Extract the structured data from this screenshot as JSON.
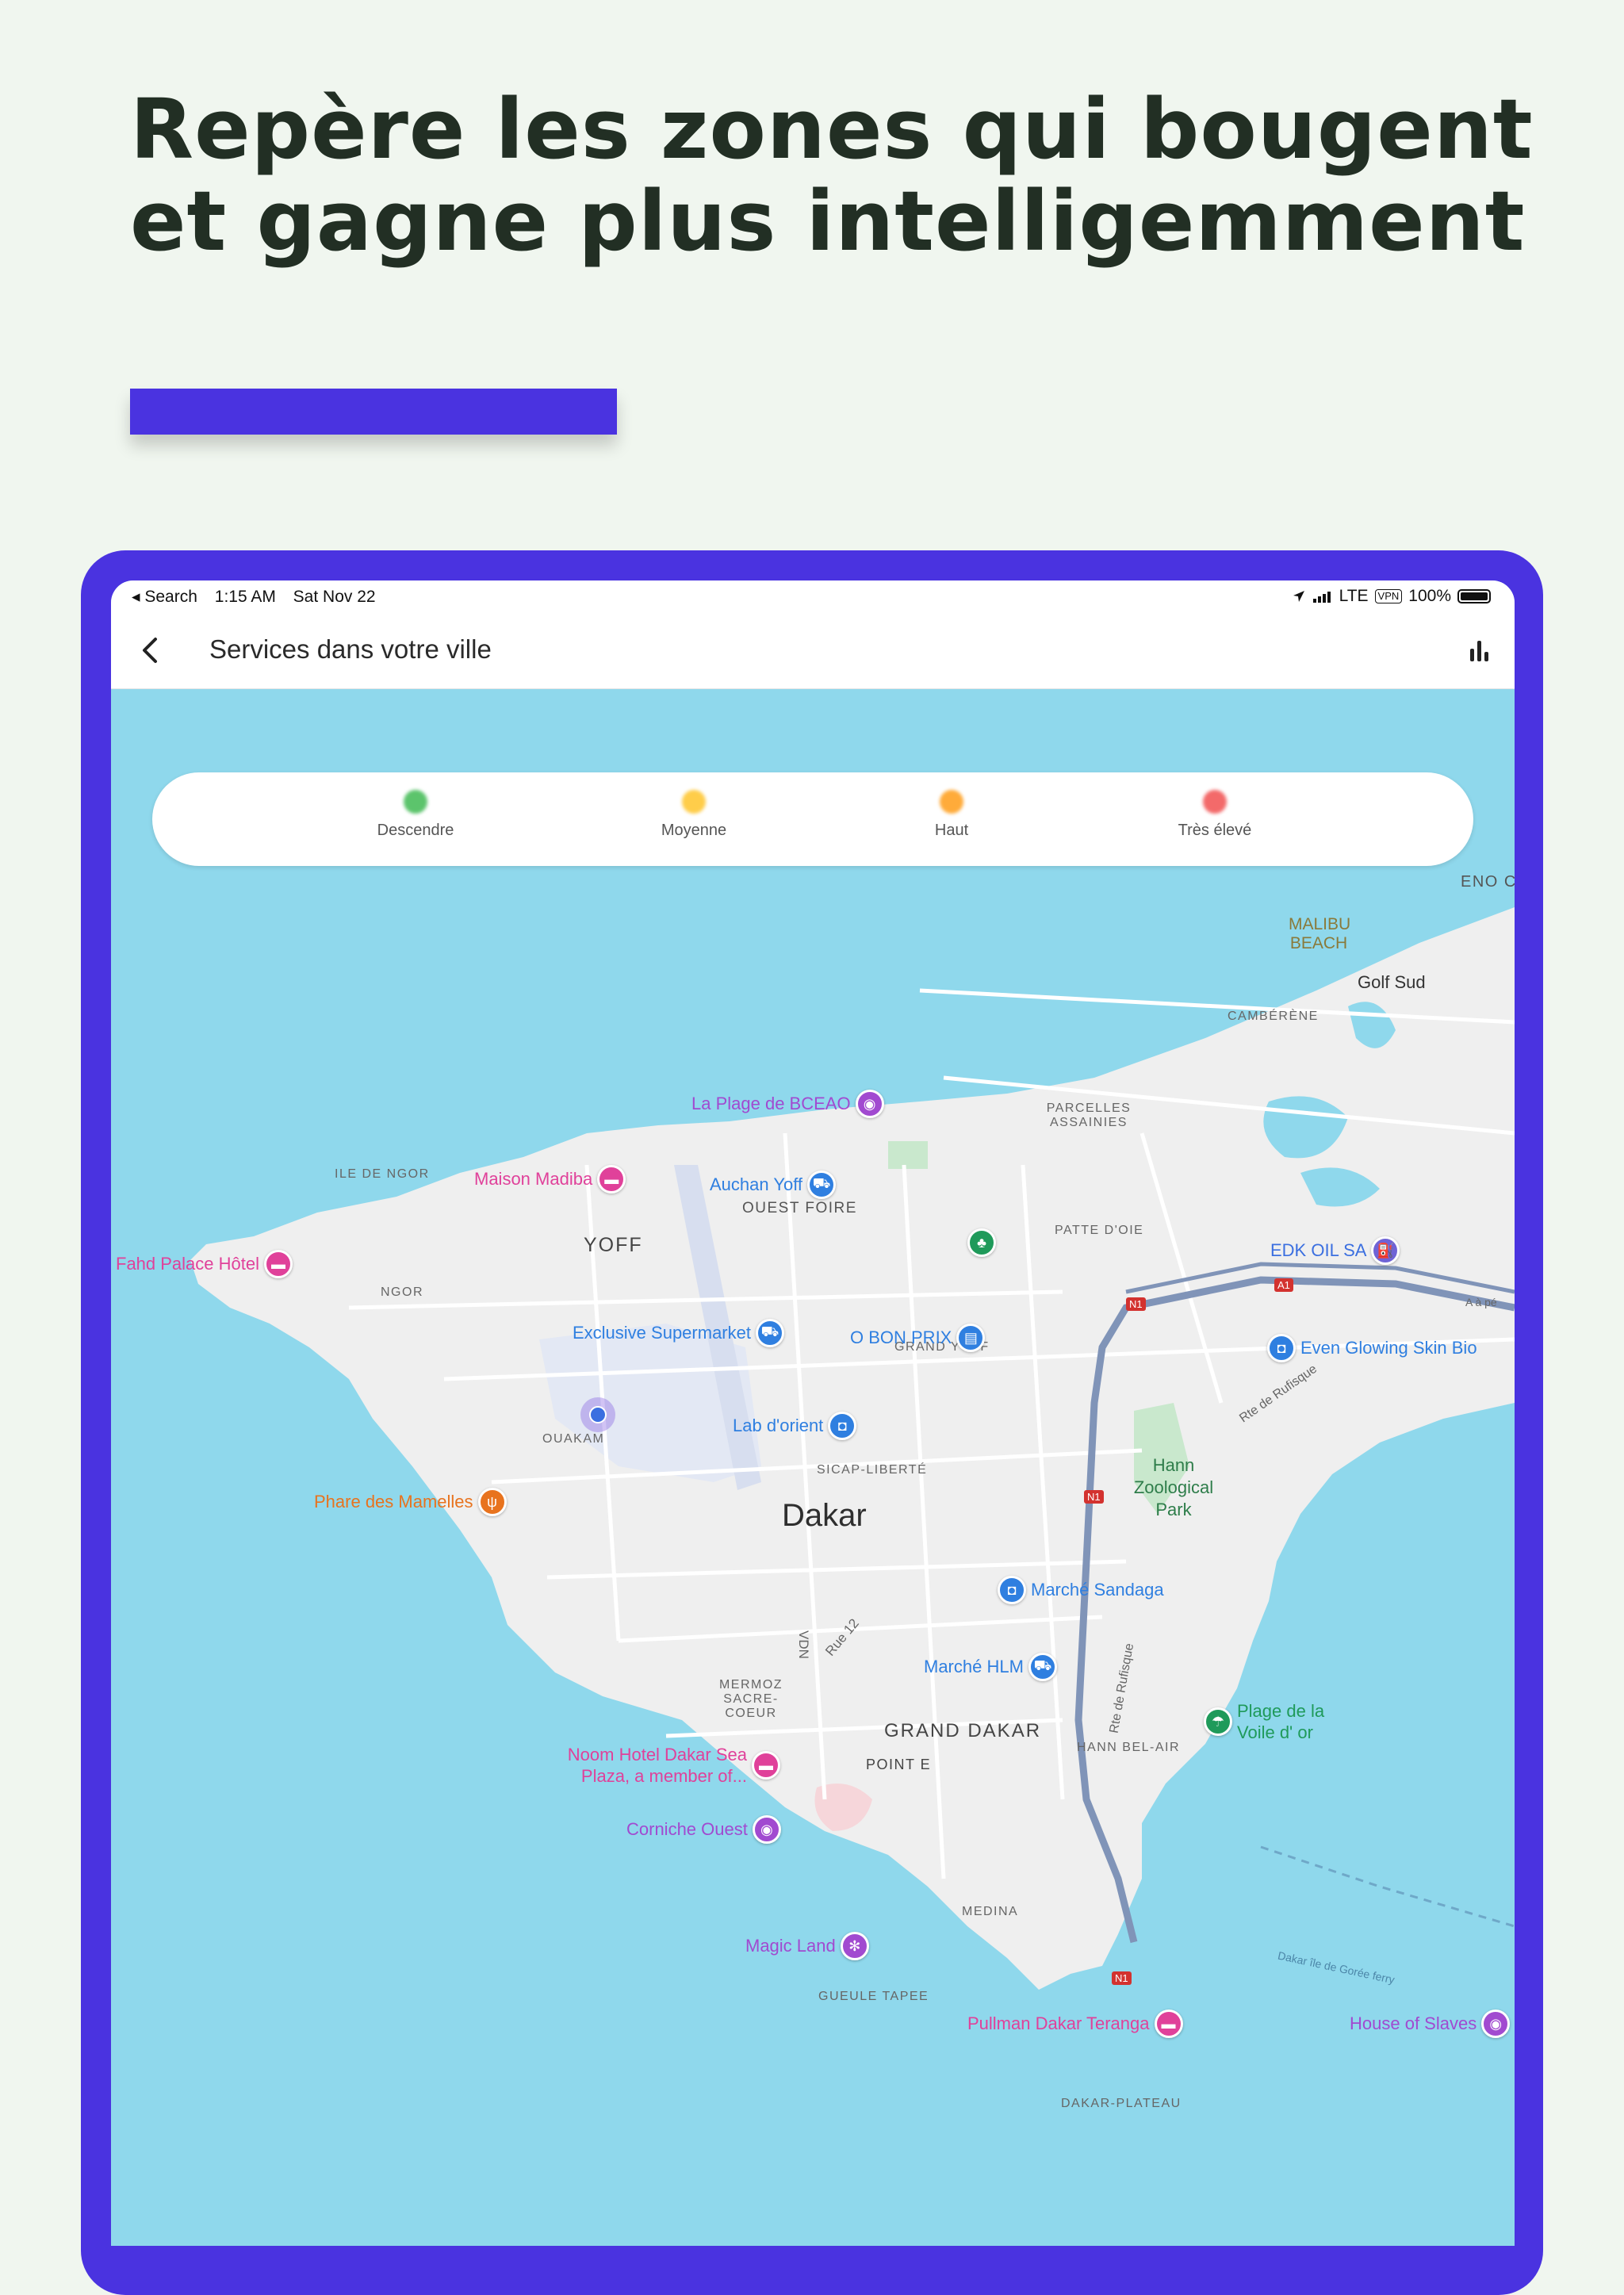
{
  "headline": {
    "line1": "Repère les zones qui bougent",
    "line2": "et gagne plus intelligemment"
  },
  "statusbar": {
    "back_app": "◂ Search",
    "time": "1:15 AM",
    "date": "Sat Nov 22",
    "network": "LTE",
    "vpn": "VPN",
    "battery": "100%"
  },
  "appbar": {
    "title": "Services dans votre ville"
  },
  "legend": {
    "items": [
      {
        "label": "Descendre",
        "color": "#5cc46c"
      },
      {
        "label": "Moyenne",
        "color": "#ffcd4a"
      },
      {
        "label": "Haut",
        "color": "#ffab3a"
      },
      {
        "label": "Très élevé",
        "color": "#f36a6a"
      }
    ]
  },
  "map": {
    "city": "Dakar",
    "districts": {
      "yoff": "YOFF",
      "ouest_foire": "OUEST FOIRE",
      "ile_de_ngor": "ILE DE NGOR",
      "ngor": "NGOR",
      "ouakam": "OUAKAM",
      "patte_doie": "PATTE D'OIE",
      "parcelles": "PARCELLES ASSAINIES",
      "cambere": "CAMBÉRÈNE",
      "grand_yoff": "GRAND YOFF",
      "sicap": "SICAP-LIBERTÉ",
      "mermoz": "MERMOZ SACRE-COEUR",
      "grand_dakar": "GRAND DAKAR",
      "point_e": "POINT E",
      "hann_bel_air": "HANN BEL-AIR",
      "medina": "MEDINA",
      "gueule_tapee": "GUEULE TAPEE",
      "dakar_plateau": "DAKAR-PLATEAU",
      "golf_sud": "Golf Sud",
      "malibu": "MALIBU BEACH",
      "eno": "ENO C"
    },
    "roads": {
      "vdn": "VDN",
      "rue12": "Rue 12",
      "rte_rufisque1": "Rte de Rufisque",
      "rte_rufisque2": "Rte de Rufisque",
      "ferry": "Dakar île de Gorée ferry",
      "n1": "N1",
      "a1": "A1",
      "a_pe": "A à pé"
    },
    "places": {
      "plage_bceao": "La Plage de BCEAO",
      "maison_madiba": "Maison Madiba",
      "auchan": "Auchan Yoff",
      "fahd": "Fahd Palace Hôtel",
      "exclusive": "Exclusive Supermarket",
      "obonprix": "O BON PRIX",
      "edk": "EDK OIL SA",
      "even": "Even Glowing Skin Bio",
      "lab": "Lab d'orient",
      "phare": "Phare des Mamelles",
      "hann_park": "Hann Zoological Park",
      "sandaga": "Marché Sandaga",
      "hlm": "Marché HLM",
      "plage_voile": "Plage de la Voile d' or",
      "noom": "Noom Hotel Dakar Sea Plaza, a member of...",
      "corniche": "Corniche Ouest",
      "magic": "Magic Land",
      "pullman": "Pullman Dakar Teranga",
      "slaves": "House of Slaves"
    },
    "icons": {
      "hotel": "bed-icon",
      "shop": "cart-icon",
      "camera": "camera-icon",
      "store": "store-icon",
      "bag": "shopping-bag-icon",
      "park": "tree-icon",
      "fuel": "fuel-icon",
      "restaurant": "fork-knife-icon",
      "beach": "umbrella-icon",
      "amusement": "ferris-wheel-icon"
    }
  }
}
